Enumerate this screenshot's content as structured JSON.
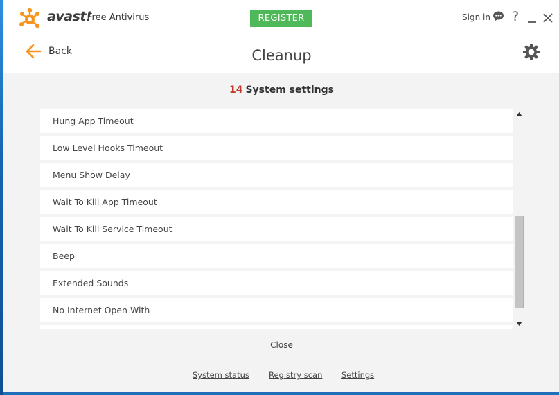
{
  "window": {
    "brand_text": "avast!",
    "product_name": "Free Antivirus",
    "register_label": "REGISTER",
    "sign_in_label": "Sign in",
    "help_symbol": "?"
  },
  "header": {
    "back_label": "Back",
    "title": "Cleanup"
  },
  "section": {
    "count": "14",
    "label": "System settings"
  },
  "items": [
    {
      "label": "Hung App Timeout"
    },
    {
      "label": "Low Level Hooks Timeout"
    },
    {
      "label": "Menu Show Delay"
    },
    {
      "label": "Wait To Kill App Timeout"
    },
    {
      "label": "Wait To Kill Service Timeout"
    },
    {
      "label": "Beep"
    },
    {
      "label": "Extended Sounds"
    },
    {
      "label": "No Internet Open With"
    }
  ],
  "close_label": "Close",
  "footer": {
    "system_status": "System status",
    "registry_scan": "Registry scan",
    "settings": "Settings"
  },
  "colors": {
    "brand_orange": "#f7941d",
    "register_green": "#4fb95a",
    "count_red": "#c0392b",
    "desktop_blue": "#1c6fb8"
  },
  "icons": {
    "logo": "avast-logo-icon",
    "chat": "chat-bubble-icon",
    "help": "help-icon",
    "minimize": "minimize-icon",
    "close": "close-icon",
    "back": "arrow-left-icon",
    "settings": "gear-icon"
  }
}
